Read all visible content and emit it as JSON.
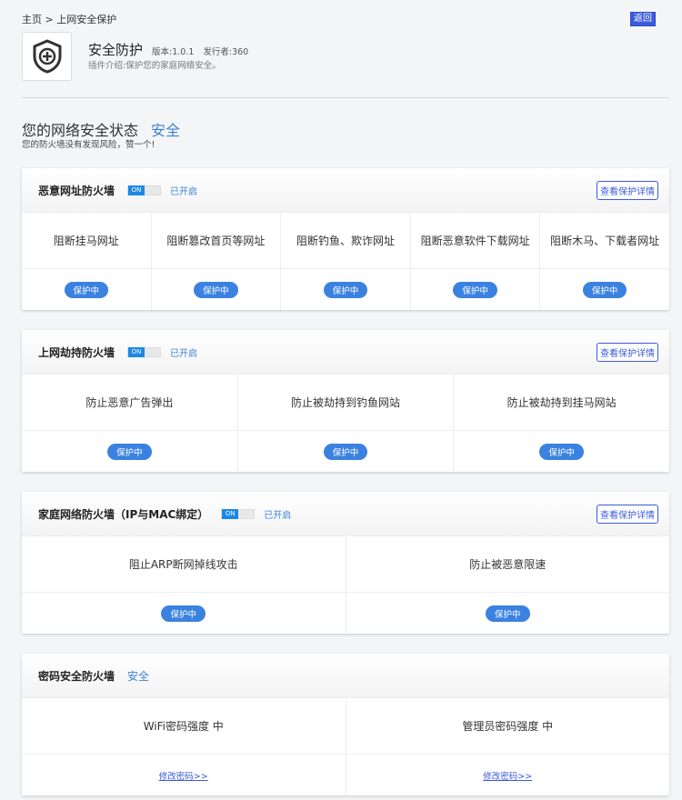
{
  "breadcrumb": "主页 > 上网安全保护",
  "back_label": "返回",
  "plugin": {
    "icon": "shield-plus-icon",
    "title": "安全防护",
    "version": "版本:1.0.1",
    "publisher": "发行者:360",
    "description": "插件介绍:保护您的家庭网络安全。"
  },
  "status": {
    "heading": "您的网络安全状态",
    "value": "安全",
    "subtitle": "您的防火墙没有发现风险，赞一个!"
  },
  "accent": "#3b82d6",
  "cards": [
    {
      "title": "恶意网址防火墙",
      "toggle": "ON",
      "state": "已开启",
      "details": "查看保护详情",
      "items": [
        {
          "label": "阻断挂马网址",
          "status": "保护中"
        },
        {
          "label": "阻断篡改首页等网址",
          "status": "保护中"
        },
        {
          "label": "阻断钓鱼、欺诈网址",
          "status": "保护中"
        },
        {
          "label": "阻断恶意软件下载网址",
          "status": "保护中"
        },
        {
          "label": "阻断木马、下载者网址",
          "status": "保护中"
        }
      ]
    },
    {
      "title": "上网劫持防火墙",
      "toggle": "ON",
      "state": "已开启",
      "details": "查看保护详情",
      "items": [
        {
          "label": "防止恶意广告弹出",
          "status": "保护中"
        },
        {
          "label": "防止被劫持到钓鱼网站",
          "status": "保护中"
        },
        {
          "label": "防止被劫持到挂马网站",
          "status": "保护中"
        }
      ]
    },
    {
      "title": "家庭网络防火墙（IP与MAC绑定）",
      "toggle": "ON",
      "state": "已开启",
      "details": "查看保护详情",
      "items": [
        {
          "label": "阻止ARP断网掉线攻击",
          "status": "保护中"
        },
        {
          "label": "防止被恶意限速",
          "status": "保护中"
        }
      ]
    },
    {
      "title": "密码安全防火墙",
      "status": "安全",
      "items": [
        {
          "label": "WiFi密码强度 中",
          "link": "修改密码>>"
        },
        {
          "label": "管理员密码强度 中",
          "link": "修改密码>>"
        }
      ]
    }
  ]
}
